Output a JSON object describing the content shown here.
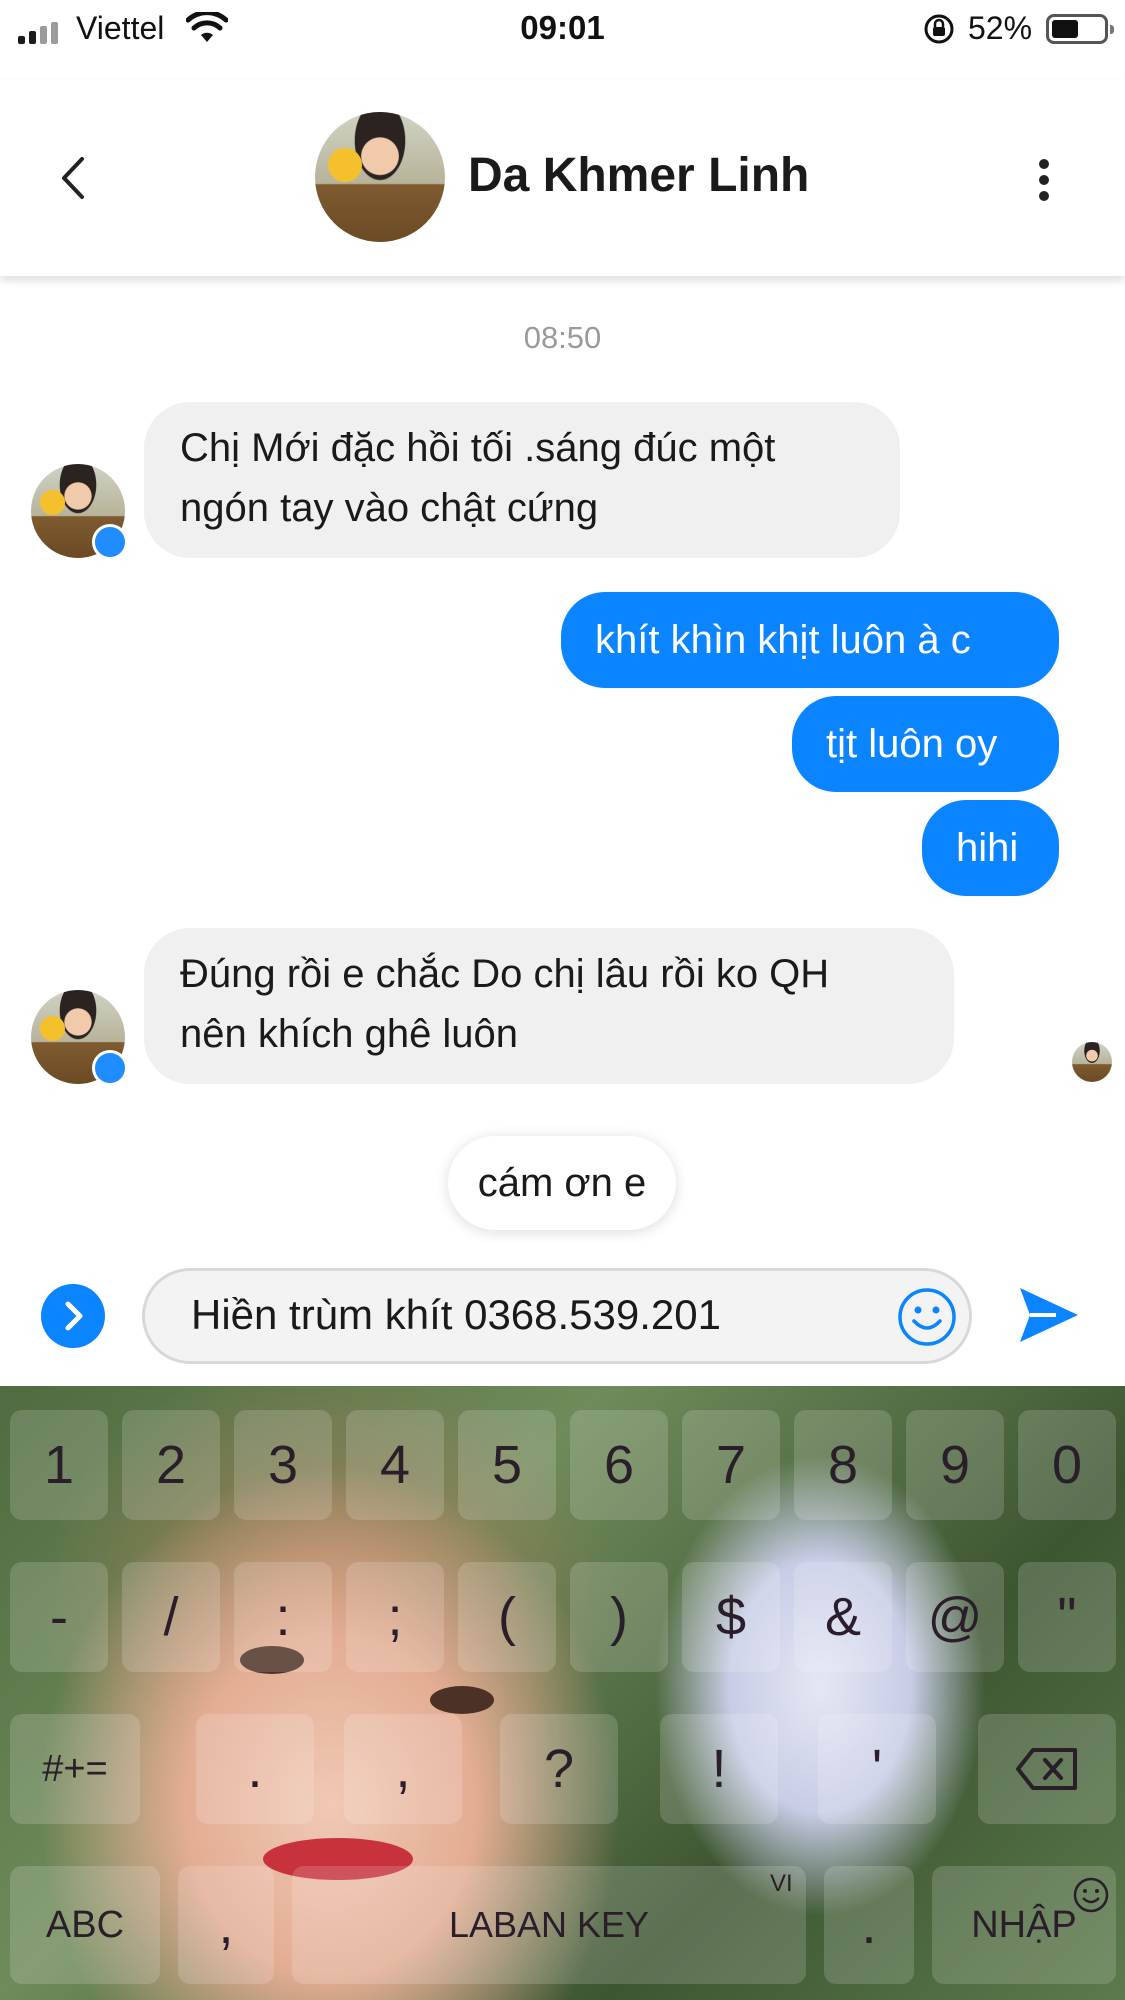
{
  "status_bar": {
    "carrier": "Viettel",
    "time": "09:01",
    "battery_percent": "52%",
    "battery_level": 0.52,
    "icons": [
      "signal-icon",
      "wifi-icon",
      "orientation-lock-icon",
      "battery-icon"
    ]
  },
  "header": {
    "contact_name": "Da Khmer Linh",
    "icons": [
      "back-chevron-icon",
      "more-vertical-icon"
    ]
  },
  "conversation": {
    "time_separator": "08:50",
    "messages": [
      {
        "direction": "incoming",
        "lines": [
          "Chị Mới đặc hồi tối .sáng đúc một",
          "ngón tay vào chật cứng"
        ]
      },
      {
        "direction": "outgoing",
        "text": "khít khìn khịt luôn à c"
      },
      {
        "direction": "outgoing",
        "text": "tịt luôn oy"
      },
      {
        "direction": "outgoing",
        "text": "hihi"
      },
      {
        "direction": "incoming",
        "lines": [
          "Đúng rồi e chắc Do chị lâu rồi ko QH",
          "nên khích ghê luôn"
        ]
      }
    ],
    "quick_reply": "cám ơn e"
  },
  "composer": {
    "text": "Hiền trùm khít 0368.539.201",
    "icons": [
      "expand-icon",
      "emoji-icon",
      "send-icon"
    ]
  },
  "keyboard": {
    "row1": [
      "1",
      "2",
      "3",
      "4",
      "5",
      "6",
      "7",
      "8",
      "9",
      "0"
    ],
    "row2": [
      "-",
      "/",
      ":",
      ";",
      "(",
      ")",
      "$",
      "&",
      "@",
      "\""
    ],
    "row3": [
      "#+=",
      ".",
      ",",
      "?",
      "!",
      "'"
    ],
    "abc": "ABC",
    "comma": ",",
    "space_label": "LABAN KEY",
    "lang_hint": "VI",
    "period": ".",
    "enter": "NHẬP",
    "icons": [
      "backspace-icon",
      "smiley-icon"
    ]
  },
  "colors": {
    "outgoing_bubble": "#0a84ff",
    "incoming_bubble": "#f0f0f0",
    "accent": "#0a84ff"
  }
}
